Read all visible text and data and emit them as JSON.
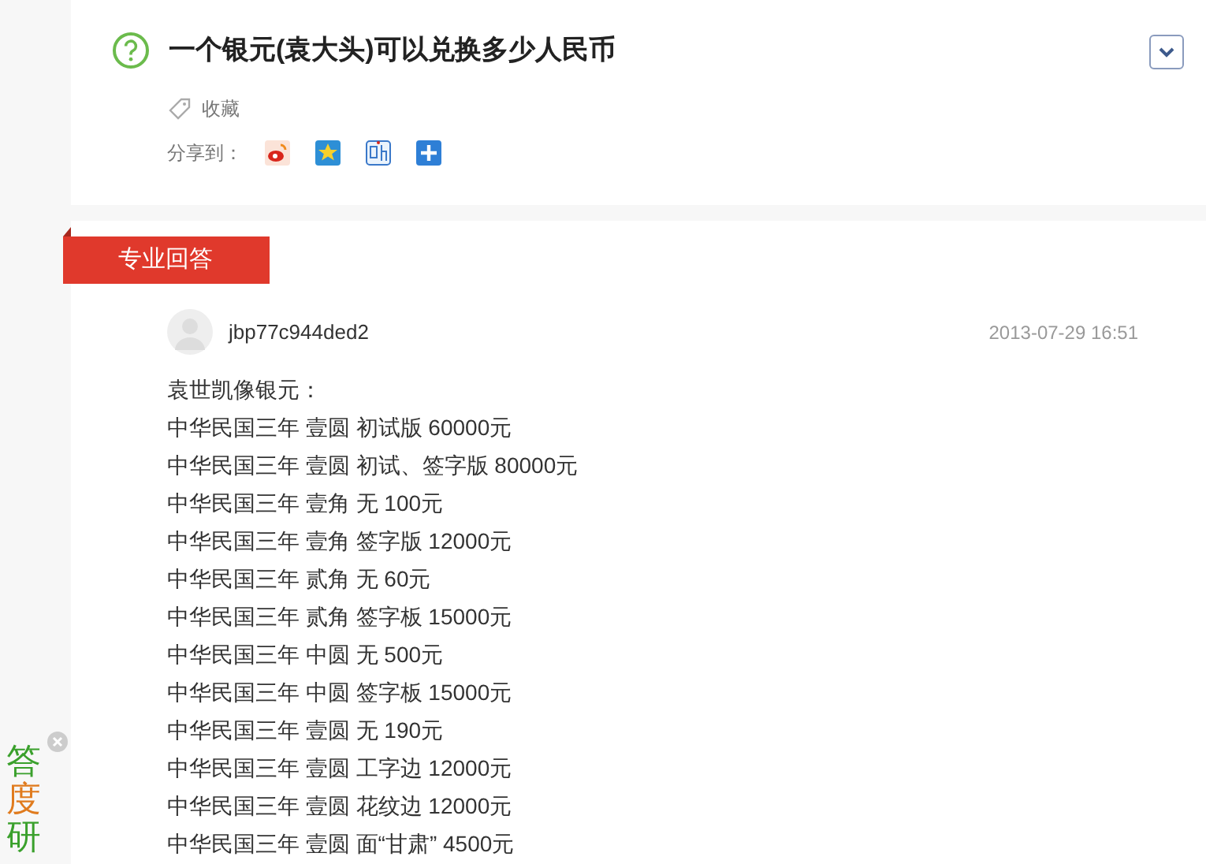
{
  "question": {
    "title": "一个银元(袁大头)可以兑换多少人民币",
    "favorite": "收藏",
    "share_label": "分享到："
  },
  "answer_tag": "专业回答",
  "answer": {
    "user": "jbp77c944ded2",
    "time": "2013-07-29 16:51",
    "lines": [
      "袁世凯像银元：",
      "中华民国三年 壹圆 初试版 60000元",
      "中华民国三年 壹圆 初试、签字版 80000元",
      "中华民国三年 壹角 无 100元",
      "中华民国三年 壹角 签字版 12000元",
      "中华民国三年 贰角 无 60元",
      "中华民国三年 贰角 签字板 15000元",
      "中华民国三年 中圆 无 500元",
      "中华民国三年 中圆 签字板 15000元",
      "中华民国三年 壹圆 无 190元",
      "中华民国三年 壹圆 工字边 12000元",
      "中华民国三年 壹圆 花纹边 12000元",
      "中华民国三年 壹圆 面“甘肃” 4500元"
    ]
  },
  "side_ad": [
    {
      "text": "答",
      "color": "#3aa02c"
    },
    {
      "text": "度",
      "color": "#e07b1e"
    },
    {
      "text": "研",
      "color": "#3aa02c"
    }
  ]
}
